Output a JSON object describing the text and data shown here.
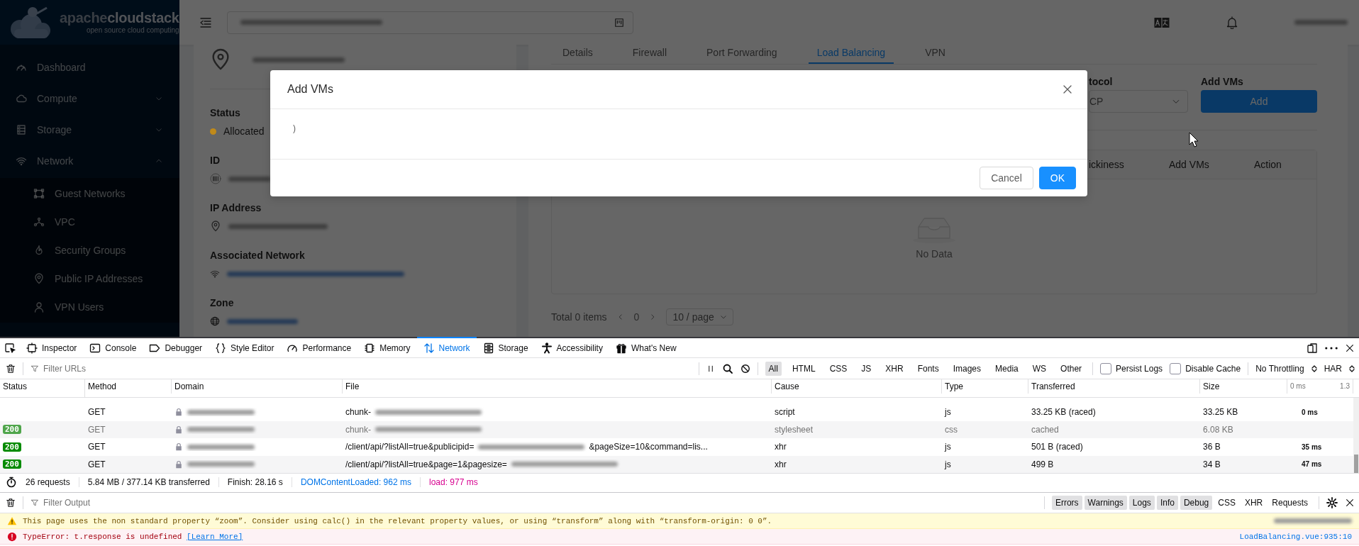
{
  "logo": {
    "wordmark": [
      "apache",
      "cloudstack"
    ],
    "tagline": "open source cloud computing"
  },
  "sidebar": [
    {
      "kind": "link",
      "label": "Dashboard"
    },
    {
      "kind": "submenu",
      "label": "Compute",
      "expanded": false
    },
    {
      "kind": "submenu",
      "label": "Storage",
      "expanded": false
    },
    {
      "kind": "submenu",
      "label": "Network",
      "expanded": true,
      "children": [
        {
          "label": "Guest Networks"
        },
        {
          "label": "VPC"
        },
        {
          "label": "Security Groups"
        },
        {
          "label": "Public IP Addresses"
        },
        {
          "label": "VPN Users"
        }
      ]
    }
  ],
  "details": [
    {
      "label": "Status",
      "kind": "status",
      "value": "Allocated",
      "color": "#c08a1a"
    },
    {
      "label": "ID",
      "kind": "redacted"
    },
    {
      "label": "IP Address",
      "kind": "redacted"
    },
    {
      "label": "Associated Network",
      "kind": "redacted_link"
    },
    {
      "label": "Zone",
      "kind": "redacted_link"
    }
  ],
  "tabs": [
    {
      "label": "Details",
      "selected": false
    },
    {
      "label": "Firewall",
      "selected": false
    },
    {
      "label": "Port Forwarding",
      "selected": false
    },
    {
      "label": "Load Balancing",
      "selected": true
    },
    {
      "label": "VPN",
      "selected": false
    }
  ],
  "form": [
    {
      "kind": "select",
      "label": "tocol",
      "value": "CP"
    },
    {
      "kind": "button",
      "label": "Add VMs",
      "value": "Add"
    }
  ],
  "table": {
    "columns": [
      "ickiness",
      "Add VMs",
      "Action"
    ],
    "empty_text": "No Data"
  },
  "pagination": {
    "total": "Total 0 items",
    "page": "0",
    "page_size": "10 / page"
  },
  "modal": {
    "title": "Add VMs",
    "body": ")",
    "buttons": [
      {
        "label": "Cancel",
        "primary": false
      },
      {
        "label": "OK",
        "primary": true
      }
    ]
  },
  "devtools": {
    "tabs": [
      {
        "label": "Inspector",
        "selected": false
      },
      {
        "label": "Console",
        "selected": false
      },
      {
        "label": "Debugger",
        "selected": false
      },
      {
        "label": "Style Editor",
        "selected": false
      },
      {
        "label": "Performance",
        "selected": false
      },
      {
        "label": "Memory",
        "selected": false
      },
      {
        "label": "Network",
        "selected": true
      },
      {
        "label": "Storage",
        "selected": false
      },
      {
        "label": "Accessibility",
        "selected": false
      },
      {
        "label": "What's New",
        "selected": false
      }
    ],
    "filter_placeholder": "Filter URLs",
    "type_filters": [
      {
        "label": "All",
        "selected": true
      },
      {
        "label": "HTML",
        "selected": false
      },
      {
        "label": "CSS",
        "selected": false
      },
      {
        "label": "JS",
        "selected": false
      },
      {
        "label": "XHR",
        "selected": false
      },
      {
        "label": "Fonts",
        "selected": false
      },
      {
        "label": "Images",
        "selected": false
      },
      {
        "label": "Media",
        "selected": false
      },
      {
        "label": "WS",
        "selected": false
      },
      {
        "label": "Other",
        "selected": false
      }
    ],
    "options": [
      {
        "label": "Persist Logs",
        "checked": false
      },
      {
        "label": "Disable Cache",
        "checked": false
      }
    ],
    "throttling": "No Throttling",
    "har": "HAR",
    "columns": [
      "Status",
      "Method",
      "Domain",
      "File",
      "Cause",
      "Type",
      "Transferred",
      "Size"
    ],
    "waterfall_ticks": [
      "0 ms",
      "1.3"
    ],
    "requests": [
      {
        "method": "GET",
        "file": [
          {
            "kind": "text",
            "text": "chunk-"
          },
          {
            "kind": "blur"
          }
        ],
        "cause": "script",
        "type": "js",
        "transferred": "33.25 KB (raced)",
        "size": "33.25 KB",
        "timing": "0 ms",
        "cached": false
      },
      {
        "status": "200",
        "method": "GET",
        "file": [
          {
            "kind": "text",
            "text": "chunk-"
          },
          {
            "kind": "blur"
          }
        ],
        "cause": "stylesheet",
        "type": "css",
        "transferred": "cached",
        "size": "6.08 KB",
        "cached": true
      },
      {
        "status": "200",
        "method": "GET",
        "file": [
          {
            "kind": "text",
            "text": "/client/api/?listAll=true&publicipid="
          },
          {
            "kind": "blur"
          },
          {
            "kind": "text",
            "text": "&pageSize=10&command=lis..."
          }
        ],
        "cause": "xhr",
        "type": "js",
        "transferred": "501 B (raced)",
        "size": "36 B",
        "timing": "35 ms",
        "cached": false
      },
      {
        "status": "200",
        "method": "GET",
        "file": [
          {
            "kind": "text",
            "text": "/client/api/?listAll=true&page=1&pagesize="
          },
          {
            "kind": "blur"
          }
        ],
        "cause": "xhr",
        "type": "js",
        "transferred": "499 B",
        "size": "34 B",
        "timing": "47 ms",
        "cached": false
      }
    ],
    "summary": [
      {
        "kind": "plain",
        "text": "26 requests"
      },
      {
        "kind": "plain",
        "text": "5.84 MB / 377.14 KB transferred"
      },
      {
        "kind": "plain",
        "text": "Finish: 28.16 s"
      },
      {
        "kind": "dom",
        "text": "DOMContentLoaded: 962 ms"
      },
      {
        "kind": "load",
        "text": "load: 977 ms"
      }
    ],
    "console": {
      "filter_placeholder": "Filter Output",
      "levels": [
        {
          "label": "Errors",
          "selected": true
        },
        {
          "label": "Warnings",
          "selected": true
        },
        {
          "label": "Logs",
          "selected": true
        },
        {
          "label": "Info",
          "selected": true
        },
        {
          "label": "Debug",
          "selected": true
        },
        {
          "label": "CSS",
          "selected": false
        },
        {
          "label": "XHR",
          "selected": false
        },
        {
          "label": "Requests",
          "selected": false
        }
      ],
      "messages": [
        {
          "kind": "warning",
          "text": "This page uses the non standard property “zoom”. Consider using calc() in the relevant property values, or using “transform” along with “transform-origin: 0 0”."
        },
        {
          "kind": "error",
          "text": "TypeError: t.response is undefined",
          "link": "[Learn More]",
          "source": "LoadBalancing.vue:935:10"
        }
      ]
    }
  }
}
